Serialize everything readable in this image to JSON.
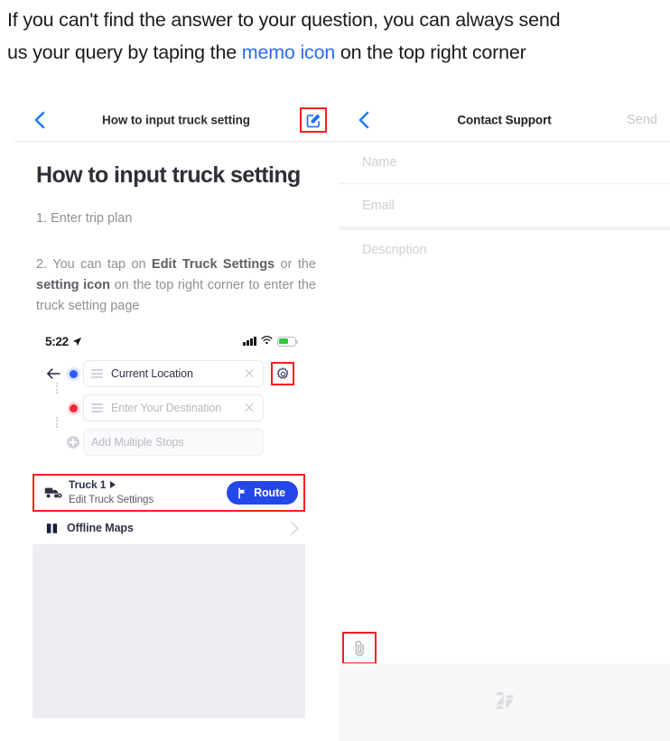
{
  "caption": {
    "line1": "If you can't find the answer to your question, you can always send",
    "line2_pre": "us your query by taping the ",
    "line2_link": "memo icon",
    "line2_post": " on the top right corner",
    "link_color": "#2a6df4"
  },
  "left_panel": {
    "navbar": {
      "back_icon": "chevron-left-icon",
      "title": "How to input truck setting",
      "memo_icon": "compose-memo-icon",
      "memo_highlight_color": "#f71f1f",
      "memo_icon_color": "#1f6bff"
    },
    "article": {
      "title": "How to input truck setting",
      "step1": "1. Enter trip plan",
      "step2_a": "2. You can tap on ",
      "step2_b_bold": "Edit Truck Settings",
      "step2_c": " or the ",
      "step2_d_bold": "setting icon",
      "step2_e": " on the top right corner to enter the truck setting page"
    },
    "mock": {
      "statusbar": {
        "time": "5:22",
        "location_icon": "location-arrow-icon",
        "signal_icon": "cellular-signal-icon",
        "wifi_icon": "wifi-icon",
        "battery_icon": "battery-charging-icon",
        "battery_color": "#28c940"
      },
      "rows": [
        {
          "back_icon": "arrow-left-icon",
          "marker_icon": "origin-dot-icon",
          "marker_color": "#2b5aff",
          "handle_icon": "drag-handle-icon",
          "text": "Current Location",
          "is_placeholder": false,
          "clear_icon": "close-x-icon",
          "gear_icon": "gear-settings-icon",
          "gear_highlight_color": "#f71f1f"
        },
        {
          "marker_icon": "destination-dot-icon",
          "marker_color": "#f0283c",
          "handle_icon": "drag-handle-icon",
          "text": "Enter Your Destination",
          "is_placeholder": true,
          "clear_icon": "close-x-icon"
        },
        {
          "marker_icon": "plus-circle-icon",
          "text": "Add Multiple Stops",
          "is_placeholder": true
        }
      ],
      "truck_row": {
        "truck_icon": "truck-settings-icon",
        "title": "Truck 1",
        "expand_icon": "triangle-right-icon",
        "subtitle": "Edit Truck Settings",
        "route_button": {
          "label": "Route",
          "icon": "route-flag-icon",
          "color": "#2347e8"
        },
        "highlight_color": "#f71f1f"
      },
      "offline_maps": {
        "icon": "map-book-icon",
        "label": "Offline Maps",
        "chevron_icon": "chevron-right-icon"
      },
      "map_placeholder_color": "#eceef4"
    }
  },
  "right_panel": {
    "navbar": {
      "back_icon": "chevron-left-icon",
      "title": "Contact Support",
      "send_label": "Send"
    },
    "form": {
      "name_placeholder": "Name",
      "email_placeholder": "Email",
      "description_placeholder": "Description"
    },
    "attachment": {
      "icon": "paperclip-attachment-icon",
      "highlight_color": "#f71f1f"
    },
    "footer": {
      "logo_icon": "zendesk-logo-watermark"
    }
  }
}
